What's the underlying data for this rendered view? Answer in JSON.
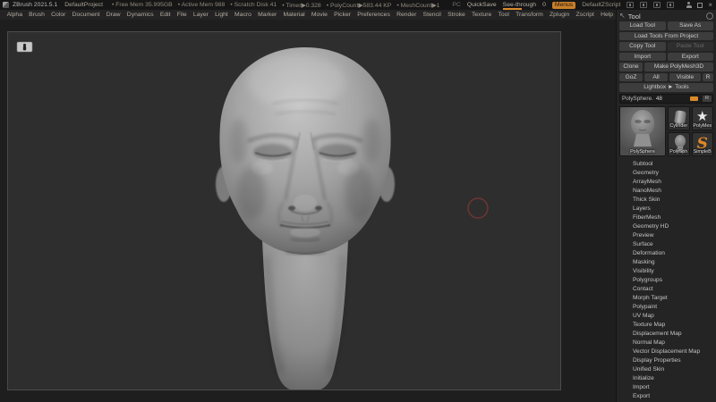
{
  "titlebar": {
    "app": "ZBrush 2021.5.1",
    "project": "DefaultProject",
    "stats": [
      "• Free Mem 35.995GB",
      "• Active Mem 988",
      "• Scratch Disk 41",
      "• Timer▶0.328",
      "• PolyCount▶583.44 KP",
      "• MeshCount▶1"
    ],
    "pc": "PC",
    "quicksave": "QuickSave",
    "see_through_label": "See-through",
    "see_through_value": "0",
    "menus": "Menus",
    "zscript": "DefaultZScript"
  },
  "menubar": {
    "items": [
      "Alpha",
      "Brush",
      "Color",
      "Document",
      "Draw",
      "Dynamics",
      "Edit",
      "File",
      "Layer",
      "Light",
      "Macro",
      "Marker",
      "Material",
      "Movie",
      "Picker",
      "Preferences",
      "Render",
      "Stencil",
      "Stroke",
      "Texture",
      "Tool",
      "Transform",
      "Zplugin",
      "Zscript",
      "Help"
    ]
  },
  "tool": {
    "title": "Tool",
    "load_tool": "Load Tool",
    "save_as": "Save As",
    "load_tools_from_project": "Load Tools From Project",
    "copy_tool": "Copy Tool",
    "paste_tool": "Paste Tool",
    "import": "Import",
    "export": "Export",
    "clone": "Clone",
    "make_polymesh3d": "Make PolyMesh3D",
    "goz": "GoZ",
    "all": "All",
    "visible": "Visible",
    "goz_r": "R",
    "lightbox_tools": "Lightbox ► Tools",
    "active_tool": {
      "name": "PolySphere.",
      "count": "48",
      "r": "R"
    },
    "quick_picks": [
      "PolySphere",
      "Cylinder",
      "PolyMes",
      "PolySph",
      "SimpleB"
    ],
    "subpalettes": [
      "Subtool",
      "Geometry",
      "ArrayMesh",
      "NanoMesh",
      "Thick Skin",
      "Layers",
      "FiberMesh",
      "Geometry HD",
      "Preview",
      "Surface",
      "Deformation",
      "Masking",
      "Visibility",
      "Polygroups",
      "Contact",
      "Morph Target",
      "Polypaint",
      "UV Map",
      "Texture Map",
      "Displacement Map",
      "Normal Map",
      "Vector Displacement Map",
      "Display Properties",
      "Unified Skin",
      "Initialize",
      "Import",
      "Export"
    ]
  },
  "canvas": {
    "model": "sculpted male head with closed eyes on tapered neck",
    "brush_cursor": "red circle outline"
  },
  "icons": {
    "axis_red_arrow": "left",
    "axis_green_arrow": "down",
    "axis_blue_cube": "corner",
    "polymesh_star": "★"
  },
  "colors": {
    "accent_orange": "#d98a2b",
    "menus_orange": "#c87e2a",
    "axis_red": "#c1272d",
    "axis_green": "#2bc42b",
    "axis_blue": "#1f2bd6",
    "canvas_bg": "#2e2e2e",
    "cursor_red": "#a53a3a"
  }
}
